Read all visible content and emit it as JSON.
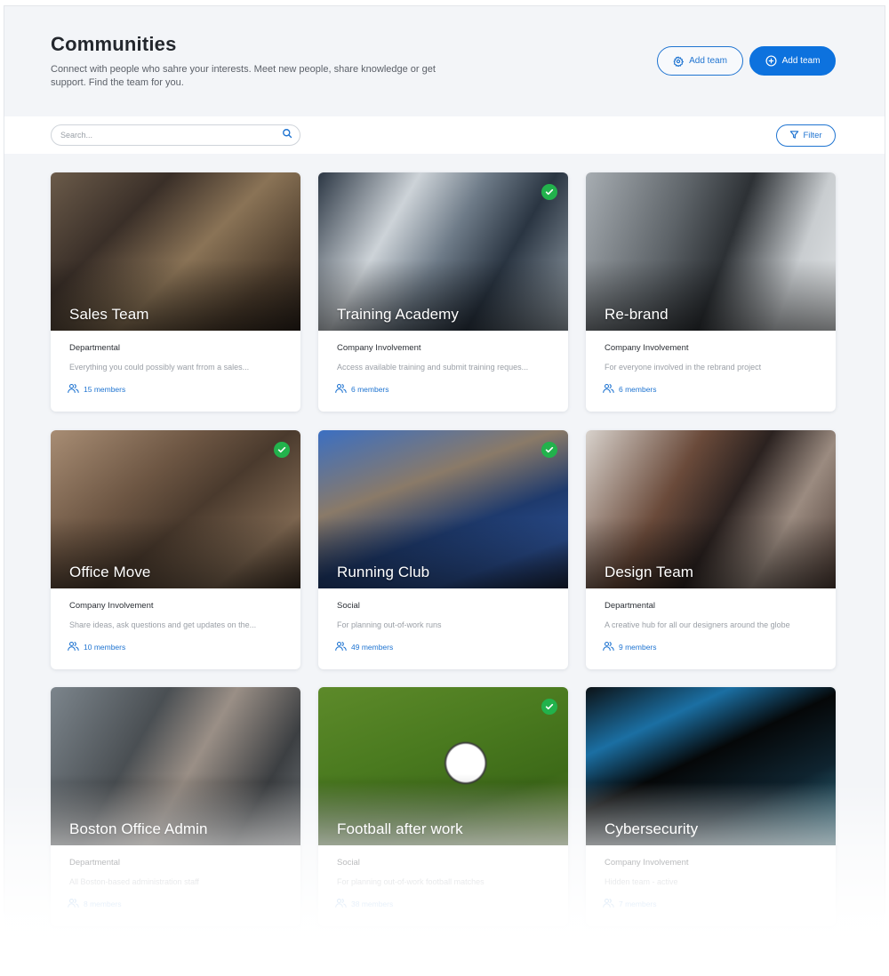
{
  "header": {
    "title": "Communities",
    "description": "Connect with people who sahre your interests. Meet new people, share knowledge or get support. Find the team for you.",
    "buttons": {
      "secondary_label": "Add team",
      "secondary_icon": "gear-icon",
      "primary_label": "Add team",
      "primary_icon": "plus-circle-icon"
    }
  },
  "toolbar": {
    "search_placeholder": "Search...",
    "search_value": "",
    "filter_label": "Filter"
  },
  "colors": {
    "accent": "#0d72de",
    "check": "#22b24c",
    "background": "#f3f5f8"
  },
  "teams": [
    {
      "name": "Sales Team",
      "category": "Departmental",
      "description": "Everything you could possibly want frrom a sales...",
      "members": "15 members",
      "joined": false,
      "image": "img-sales"
    },
    {
      "name": "Training Academy",
      "category": "Company Involvement",
      "description": "Access available training and submit training reques...",
      "members": "6 members",
      "joined": true,
      "image": "img-training"
    },
    {
      "name": "Re-brand",
      "category": "Company Involvement",
      "description": "For everyone involved in the rebrand project",
      "members": "6 members",
      "joined": false,
      "image": "img-rebrand"
    },
    {
      "name": "Office Move",
      "category": "Company Involvement",
      "description": "Share ideas, ask questions and get updates on the...",
      "members": "10 members",
      "joined": true,
      "image": "img-office"
    },
    {
      "name": "Running Club",
      "category": "Social",
      "description": "For planning out-of-work runs",
      "members": "49 members",
      "joined": true,
      "image": "img-running"
    },
    {
      "name": "Design Team",
      "category": "Departmental",
      "description": "A creative hub for all our designers around the globe",
      "members": "9 members",
      "joined": false,
      "image": "img-design"
    },
    {
      "name": "Boston Office Admin",
      "category": "Departmental",
      "description": "All Boston-based administration staff",
      "members": "8 members",
      "joined": false,
      "image": "img-boston"
    },
    {
      "name": "Football after work",
      "category": "Social",
      "description": "For planning out-of-work football matches",
      "members": "38 members",
      "joined": true,
      "image": "img-football"
    },
    {
      "name": "Cybersecurity",
      "category": "Company Involvement",
      "description": "Hidden team - active",
      "members": "7 members",
      "joined": false,
      "image": "img-cyber"
    }
  ]
}
